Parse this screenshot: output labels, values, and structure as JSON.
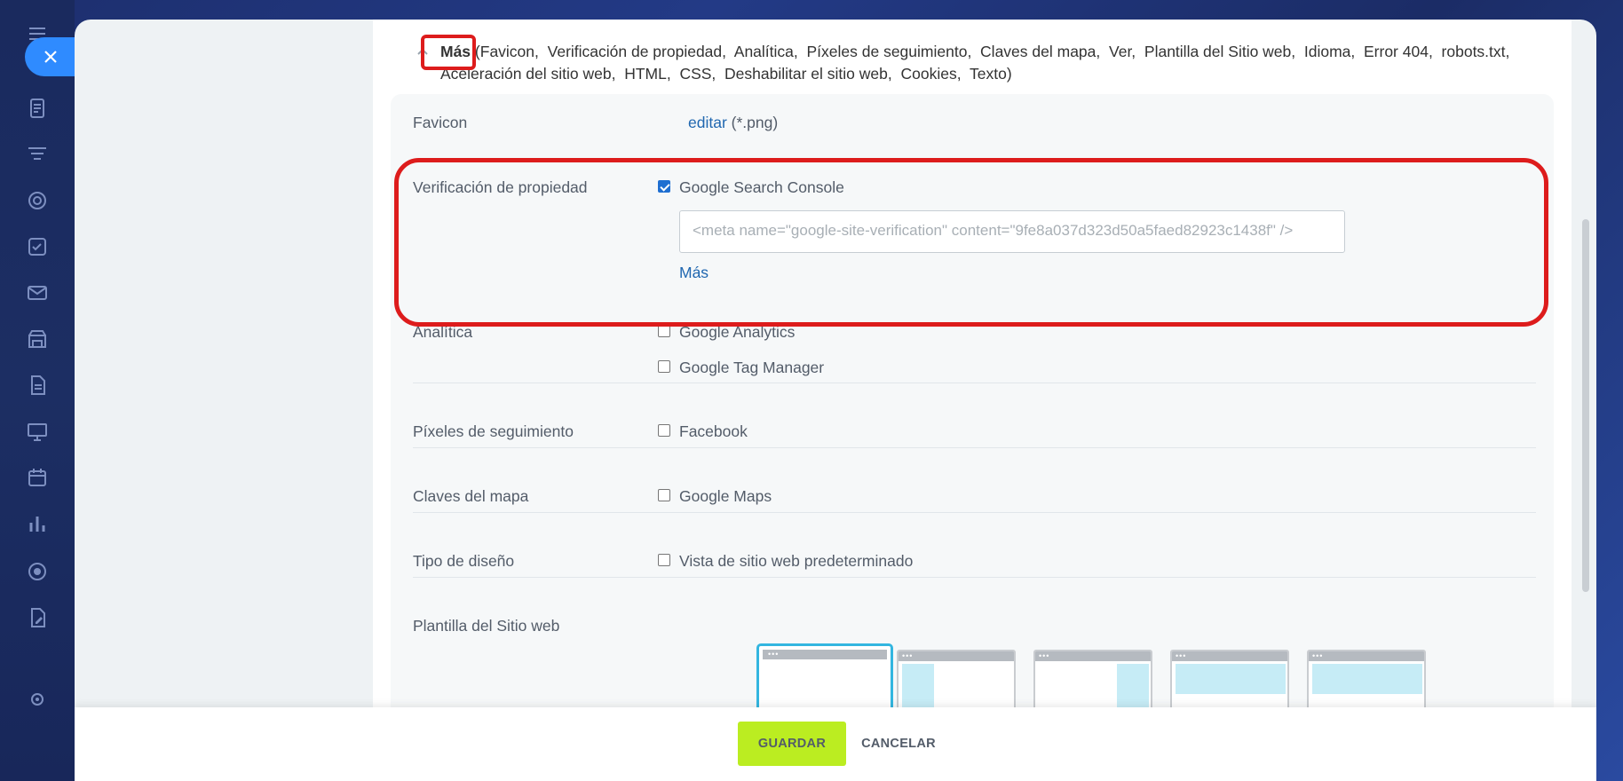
{
  "more": {
    "label": "Más",
    "list_open": "(",
    "items": [
      "Favicon,",
      "Verificación de propiedad,",
      "Analítica,",
      "Píxeles de seguimiento,",
      "Claves del mapa,",
      "Ver,",
      "Plantilla del Sitio web,",
      "Idioma,",
      "Error 404,",
      "robots.txt,",
      "Aceleración del sitio web,",
      "HTML,",
      "CSS,",
      "Deshabilitar el sitio web,",
      "Cookies,",
      "Texto"
    ],
    "list_close": ")"
  },
  "favicon": {
    "label": "Favicon",
    "edit": "editar",
    "hint": "(*.png)"
  },
  "verification": {
    "label": "Verificación de propiedad",
    "option": "Google Search Console",
    "checked": true,
    "meta_placeholder": "<meta name=\"google-site-verification\" content=\"9fe8a037d323d50a5faed82923c1438f\" />",
    "more_link": "Más"
  },
  "analytics": {
    "label": "Analítica",
    "options": [
      "Google Analytics",
      "Google Tag Manager"
    ]
  },
  "pixels": {
    "label": "Píxeles de seguimiento",
    "option": "Facebook"
  },
  "map_keys": {
    "label": "Claves del mapa",
    "option": "Google Maps"
  },
  "design": {
    "label": "Tipo de diseño",
    "option": "Vista de sitio web predeterminado"
  },
  "template": {
    "label": "Plantilla del Sitio web",
    "selected_index": 0
  },
  "footer": {
    "save": "GUARDAR",
    "cancel": "CANCELAR"
  },
  "sidebar_icons": [
    "menu-icon",
    "document-icon",
    "filter-icon",
    "target-icon",
    "checkbox-icon",
    "mail-icon",
    "store-icon",
    "file-icon",
    "presentation-icon",
    "calendar-icon",
    "chart-icon",
    "circle-icon",
    "edit-doc-icon",
    "gear-icon"
  ],
  "colors": {
    "accent": "#2f8bff",
    "save_button": "#bbed21",
    "highlight": "#dd1c1c",
    "link": "#2067b0",
    "selected_template": "#33b6e0"
  }
}
